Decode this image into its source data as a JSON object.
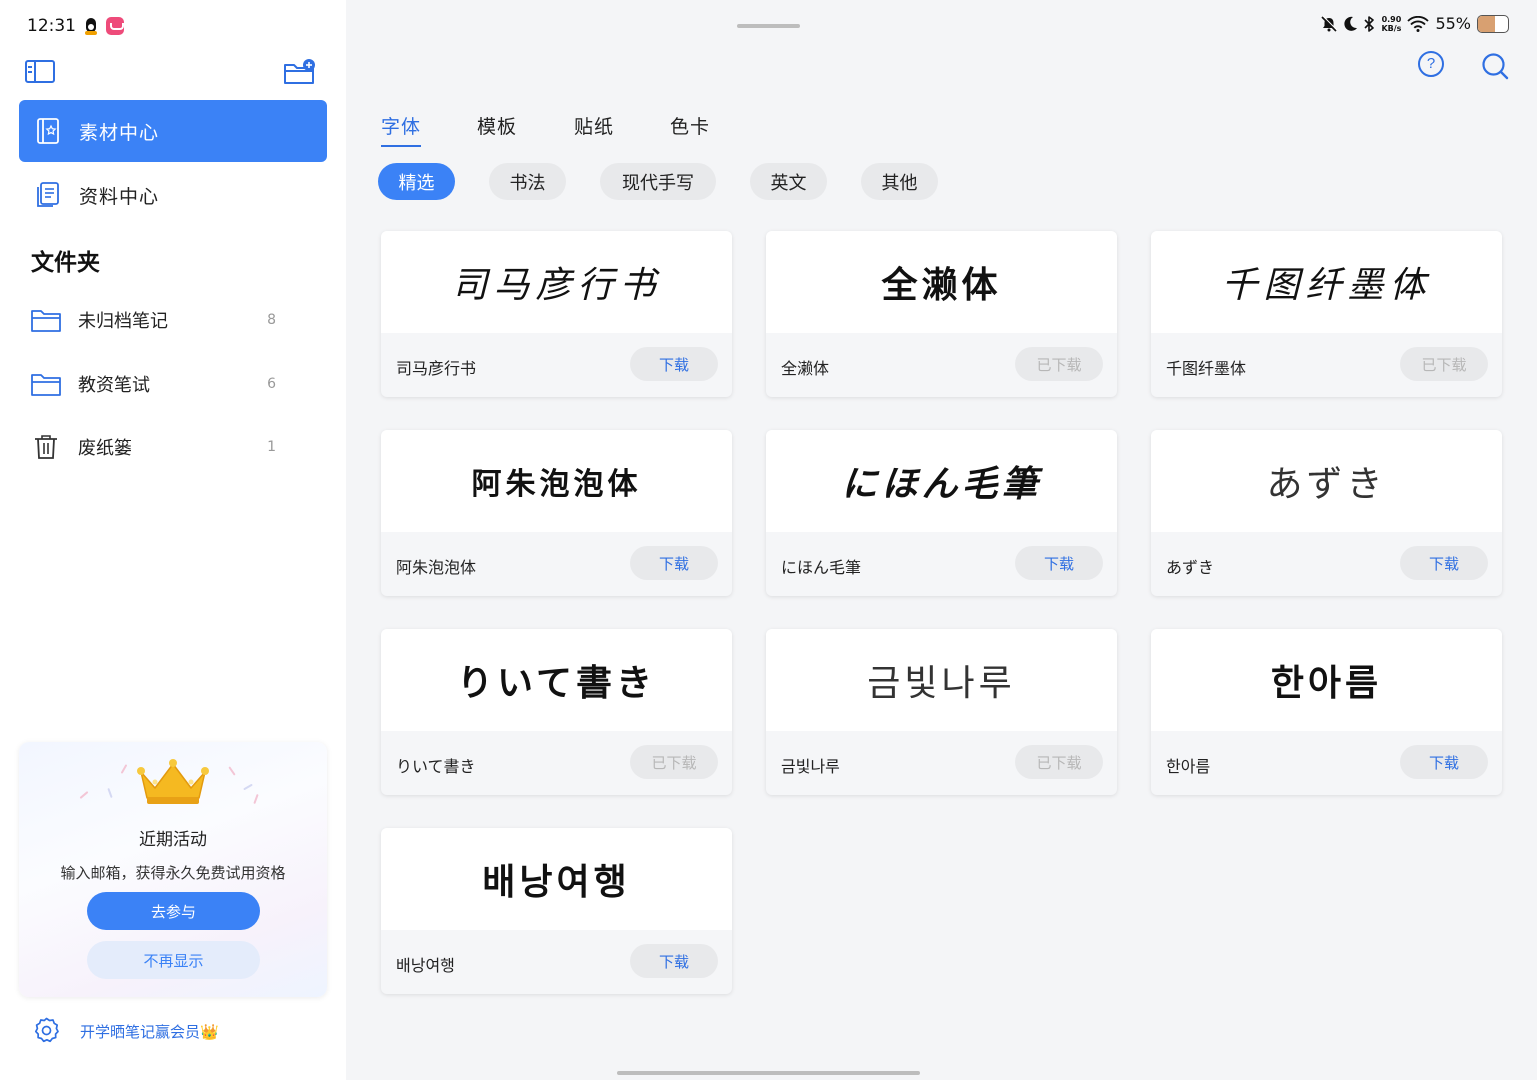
{
  "status_bar": {
    "time": "12:31",
    "net_speed_value": "0.90",
    "net_speed_unit": "KB/s",
    "battery_percent": "55%",
    "battery_level": 0.55
  },
  "sidebar": {
    "nav": [
      {
        "label": "素材中心",
        "active": true
      },
      {
        "label": "资料中心",
        "active": false
      }
    ],
    "folders_heading": "文件夹",
    "folders": [
      {
        "label": "未归档笔记",
        "count": "8"
      },
      {
        "label": "教资笔试",
        "count": "6"
      },
      {
        "label": "废纸篓",
        "count": "1"
      }
    ],
    "promo": {
      "title": "近期活动",
      "description": "输入邮箱，获得永久免费试用资格",
      "join_label": "去参与",
      "dismiss_label": "不再显示"
    },
    "bottom_link": "开学晒笔记赢会员👑"
  },
  "main": {
    "tabs": [
      {
        "label": "字体",
        "active": true
      },
      {
        "label": "模板",
        "active": false
      },
      {
        "label": "贴纸",
        "active": false
      },
      {
        "label": "色卡",
        "active": false
      }
    ],
    "filters": [
      {
        "label": "精选",
        "active": true
      },
      {
        "label": "书法",
        "active": false
      },
      {
        "label": "现代手写",
        "active": false
      },
      {
        "label": "英文",
        "active": false
      },
      {
        "label": "其他",
        "active": false
      }
    ],
    "fonts": [
      {
        "preview": "司马彦行书",
        "name": "司马彦行书",
        "button": "下载",
        "downloaded": false
      },
      {
        "preview": "全濑体",
        "name": "全濑体",
        "button": "已下载",
        "downloaded": true
      },
      {
        "preview": "千图纤墨体",
        "name": "千图纤墨体",
        "button": "已下载",
        "downloaded": true
      },
      {
        "preview": "阿朱泡泡体",
        "name": "阿朱泡泡体",
        "button": "下载",
        "downloaded": false
      },
      {
        "preview": "にほん毛筆",
        "name": "にほん毛筆",
        "button": "下载",
        "downloaded": false
      },
      {
        "preview": "あずき",
        "name": "あずき",
        "button": "下载",
        "downloaded": false
      },
      {
        "preview": "りいて書き",
        "name": "りいて書き",
        "button": "已下载",
        "downloaded": true
      },
      {
        "preview": "금빛나루",
        "name": "금빛나루",
        "button": "已下载",
        "downloaded": true
      },
      {
        "preview": "한아름",
        "name": "한아름",
        "button": "下载",
        "downloaded": false
      },
      {
        "preview": "배낭여행",
        "name": "배낭여행",
        "button": "下载",
        "downloaded": false
      }
    ]
  },
  "colors": {
    "accent": "#3b82f6",
    "accent_text": "#2f6fe2",
    "chip_bg": "#e8e9eb",
    "disabled_text": "#b7b7b7"
  }
}
